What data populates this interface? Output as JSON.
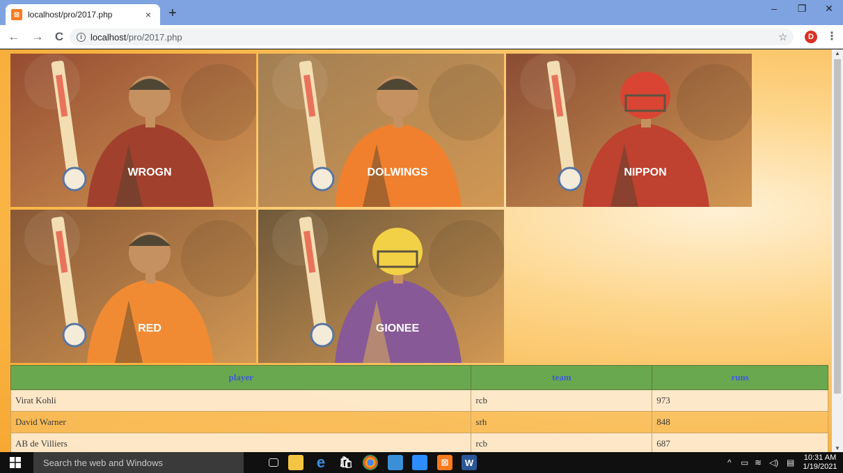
{
  "browser": {
    "tab": {
      "title": "localhost/pro/2017.php",
      "close": "×",
      "favicon": "xampp-icon"
    },
    "new_tab": "+",
    "window": {
      "minimize": "–",
      "restore": "❐",
      "close": "✕"
    },
    "nav": {
      "back": "←",
      "forward": "→",
      "reload": "C"
    },
    "url_host": "localhost",
    "url_path": "/pro/2017.php",
    "info": "i",
    "bookmark": "☆",
    "profile_initial": "D",
    "menu": "⋮"
  },
  "gallery": {
    "photos": [
      {
        "name": "kohli-photo",
        "caption": "WROGN",
        "helmet": false,
        "jersey": "#8b1a1a",
        "accent": "#1a1a1a",
        "bg": "#7a2a1f"
      },
      {
        "name": "warner-photo",
        "caption": "DOLWINGS",
        "helmet": false,
        "jersey": "#ef6c1a",
        "accent": "#1a1a1a",
        "bg": "#8a6a4a"
      },
      {
        "name": "de-villiers-photo",
        "caption": "NIPPON",
        "helmet": true,
        "jersey": "#b01c1c",
        "accent": "#1a1a1a",
        "bg": "#6b2a22"
      },
      {
        "name": "dhawan-photo",
        "caption": "RED",
        "helmet": false,
        "jersey": "#f07a20",
        "accent": "#1a1a1a",
        "bg": "#6b3a25"
      },
      {
        "name": "gambhir-photo",
        "caption": "GIONEE",
        "helmet": true,
        "jersey": "#6a3aa0",
        "accent": "#e8c23a",
        "bg": "#4a3a2a"
      }
    ]
  },
  "table": {
    "headers": {
      "player": "player",
      "team": "team",
      "runs": "runs"
    },
    "rows": [
      {
        "player": "Virat Kohli",
        "team": "rcb",
        "runs": "973"
      },
      {
        "player": "David Warner",
        "team": "srh",
        "runs": "848"
      },
      {
        "player": "AB de Villiers",
        "team": "rcb",
        "runs": "687"
      }
    ]
  },
  "taskbar": {
    "search_placeholder": "Search the web and Windows",
    "time": "10:31 AM",
    "date": "1/19/2021"
  }
}
